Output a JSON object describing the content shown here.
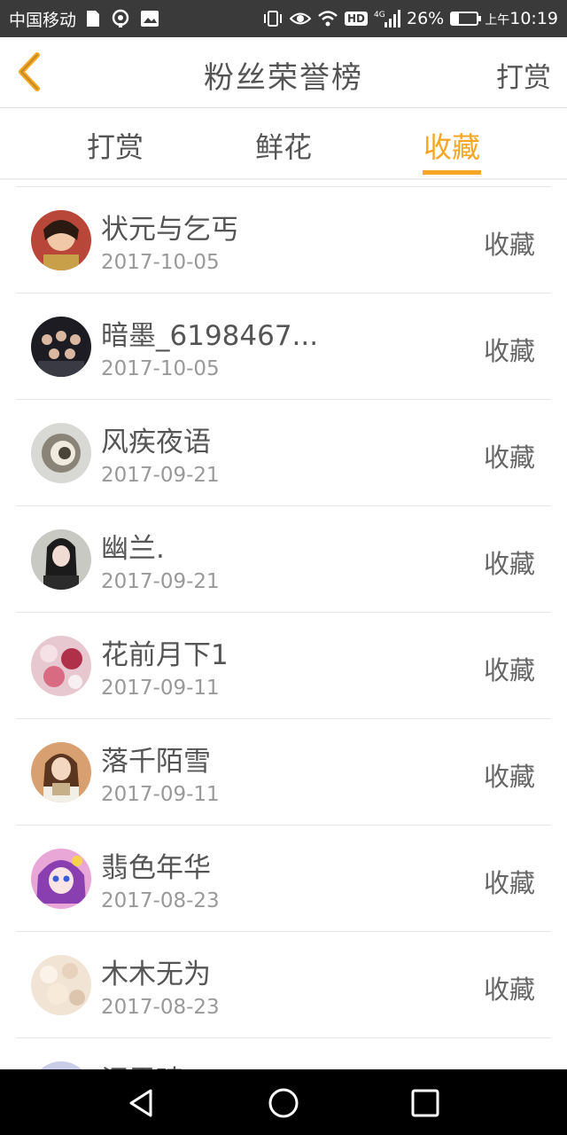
{
  "status_bar": {
    "carrier": "中国移动",
    "hd": "HD",
    "network": "4G",
    "battery_percent": "26%",
    "battery_level": 0.26,
    "ampm": "上午",
    "time": "10:19"
  },
  "header": {
    "title": "粉丝荣誉榜",
    "right_action": "打赏"
  },
  "tabs": [
    {
      "label": "打赏",
      "active": false
    },
    {
      "label": "鲜花",
      "active": false
    },
    {
      "label": "收藏",
      "active": true
    }
  ],
  "rows": [
    {
      "name": "状元与乞丐",
      "date": "2017-10-05",
      "action": "收藏"
    },
    {
      "name": "暗墨_6198467...",
      "date": "2017-10-05",
      "action": "收藏"
    },
    {
      "name": "风疾夜语",
      "date": "2017-09-21",
      "action": "收藏"
    },
    {
      "name": "幽兰.",
      "date": "2017-09-21",
      "action": "收藏"
    },
    {
      "name": "花前月下1",
      "date": "2017-09-11",
      "action": "收藏"
    },
    {
      "name": "落千陌雪",
      "date": "2017-09-11",
      "action": "收藏"
    },
    {
      "name": "翡色年华",
      "date": "2017-08-23",
      "action": "收藏"
    },
    {
      "name": "木木无为",
      "date": "2017-08-23",
      "action": "收藏"
    },
    {
      "name": "汨雪琦",
      "date": "",
      "action": ""
    }
  ],
  "colors": {
    "accent": "#f5a623",
    "status_bar": "#3a3a3a",
    "nav_bar": "#000000",
    "divider": "#e6e6e6"
  },
  "icons": {
    "back": "chevron-left-icon",
    "nav_back": "triangle-back-icon",
    "nav_home": "circle-home-icon",
    "nav_recents": "square-recents-icon"
  }
}
